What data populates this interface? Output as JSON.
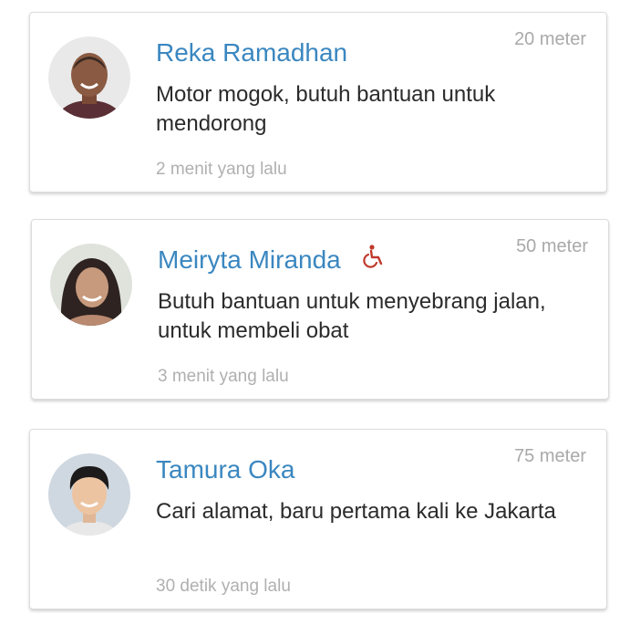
{
  "requests": [
    {
      "name": "Reka Ramadhan",
      "distance": "20 meter",
      "message": "Motor mogok, butuh bantuan untuk mendorong",
      "time": "2 menit yang lalu",
      "accessibility_icon": null
    },
    {
      "name": "Meiryta Miranda",
      "distance": "50 meter",
      "message": "Butuh bantuan untuk menyebrang jalan, untuk membeli obat",
      "time": "3 menit yang lalu",
      "accessibility_icon": "wheelchair-icon"
    },
    {
      "name": "Tamura Oka",
      "distance": "75 meter",
      "message": "Cari alamat, baru pertama kali ke Jakarta",
      "time": "30 detik yang lalu",
      "accessibility_icon": null
    }
  ],
  "colors": {
    "name": "#3a87c0",
    "distance": "#a9a9a9",
    "message": "#2b2b2b",
    "time": "#b0b0b0",
    "wheelchair": "#c0392b"
  }
}
